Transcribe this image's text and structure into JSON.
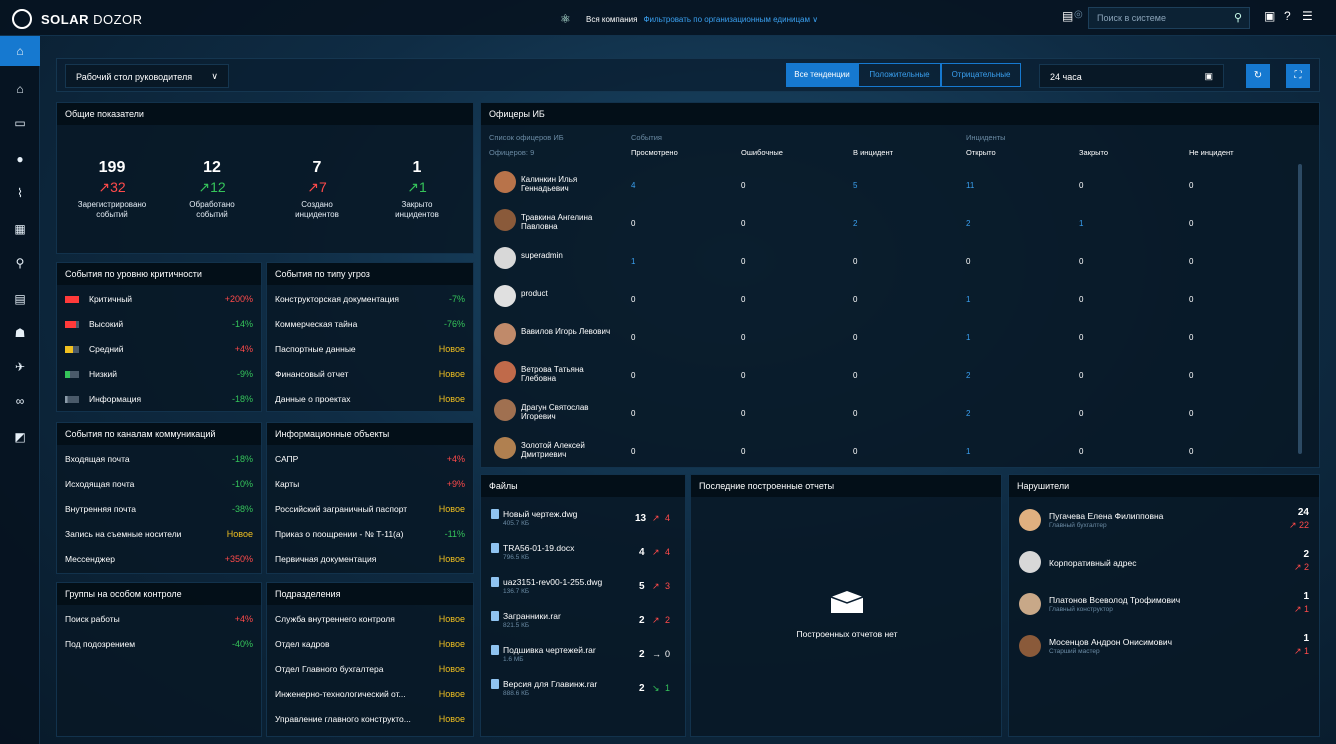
{
  "app": {
    "brand_bold": "SOLAR",
    "brand_rest": " DOZOR"
  },
  "header": {
    "company": "Вся компания",
    "filter_link": "Фильтровать по организационным единицам ∨",
    "search_placeholder": "Поиск в системе"
  },
  "toolbar": {
    "desktop_label": "Рабочий стол руководителя",
    "trend_all": "Все тенденции",
    "trend_positive": "Положительные",
    "trend_negative": "Отрицательные",
    "period": "24 часа"
  },
  "general": {
    "title": "Общие показатели",
    "items": [
      {
        "value": "199",
        "delta": "32",
        "label": "Зарегистрировано событий"
      },
      {
        "value": "12",
        "delta": "12",
        "label": "Обработано событий"
      },
      {
        "value": "7",
        "delta": "7",
        "label": "Создано инцидентов"
      },
      {
        "value": "1",
        "delta": "1",
        "label": "Закрыто инцидентов"
      }
    ]
  },
  "criticality": {
    "title": "События по уровню критичности",
    "rows": [
      {
        "label": "Критичный",
        "value": "+200%",
        "color": "#ff4a4a"
      },
      {
        "label": "Высокий",
        "value": "-14%",
        "color": "#ff4a4a"
      },
      {
        "label": "Средний",
        "value": "+4%",
        "color": "#f0c020"
      },
      {
        "label": "Низкий",
        "value": "-9%",
        "color": "#35c45a"
      },
      {
        "label": "Информация",
        "value": "-18%",
        "color": "#8a9aa8"
      }
    ]
  },
  "threats": {
    "title": "События по типу угроз",
    "rows": [
      {
        "label": "Конструкторская документация",
        "value": "-7%"
      },
      {
        "label": "Коммерческая тайна",
        "value": "-76%"
      },
      {
        "label": "Паспортные данные",
        "value": "Новое"
      },
      {
        "label": "Финансовый отчет",
        "value": "Новое"
      },
      {
        "label": "Данные о проектах",
        "value": "Новое"
      }
    ]
  },
  "channels": {
    "title": "События по каналам коммуникаций",
    "rows": [
      {
        "label": "Входящая почта",
        "value": "-18%"
      },
      {
        "label": "Исходящая почта",
        "value": "-10%"
      },
      {
        "label": "Внутренняя почта",
        "value": "-38%"
      },
      {
        "label": "Запись на съемные носители",
        "value": "Новое"
      },
      {
        "label": "Мессенджер",
        "value": "+350%"
      }
    ]
  },
  "infoobjects": {
    "title": "Информационные объекты",
    "rows": [
      {
        "label": "САПР",
        "value": "+4%"
      },
      {
        "label": "Карты",
        "value": "+9%"
      },
      {
        "label": "Российский заграничный паспорт",
        "value": "Новое"
      },
      {
        "label": "Приказ о поощрении - № Т-11(а)",
        "value": "-11%"
      },
      {
        "label": "Первичная документация",
        "value": "Новое"
      }
    ]
  },
  "groups": {
    "title": "Группы на особом контроле",
    "rows": [
      {
        "label": "Поиск работы",
        "value": "+4%"
      },
      {
        "label": "Под подозрением",
        "value": "-40%"
      }
    ]
  },
  "departments": {
    "title": "Подразделения",
    "rows": [
      {
        "label": "Служба внутреннего контроля",
        "value": "Новое"
      },
      {
        "label": "Отдел кадров",
        "value": "Новое"
      },
      {
        "label": "Отдел Главного бухгалтера",
        "value": "Новое"
      },
      {
        "label": "Инженерно-технологический от...",
        "value": "Новое"
      },
      {
        "label": "Управление главного конструкто...",
        "value": "Новое"
      }
    ]
  },
  "officers": {
    "title": "Офицеры ИБ",
    "list_label": "Список офицеров ИБ",
    "count_label": "Офицеров: 9",
    "events_group": "События",
    "incidents_group": "Инциденты",
    "columns": [
      "Просмотрено",
      "Ошибочные",
      "В инцидент",
      "Открыто",
      "Закрыто",
      "Не инцидент"
    ],
    "rows": [
      {
        "name": "Калинкин Илья Геннадьевич",
        "cells": [
          "4",
          "0",
          "5",
          "11",
          "0",
          "0"
        ]
      },
      {
        "name": "Травкина Ангелина Павловна",
        "cells": [
          "0",
          "0",
          "2",
          "2",
          "1",
          "0"
        ]
      },
      {
        "name": "superadmin",
        "cells": [
          "1",
          "0",
          "0",
          "0",
          "0",
          "0"
        ]
      },
      {
        "name": "product",
        "cells": [
          "0",
          "0",
          "0",
          "1",
          "0",
          "0"
        ]
      },
      {
        "name": "Вавилов Игорь Левович",
        "cells": [
          "0",
          "0",
          "0",
          "1",
          "0",
          "0"
        ]
      },
      {
        "name": "Ветрова Татьяна Глебовна",
        "cells": [
          "0",
          "0",
          "0",
          "2",
          "0",
          "0"
        ]
      },
      {
        "name": "Драгун Святослав Игоревич",
        "cells": [
          "0",
          "0",
          "0",
          "2",
          "0",
          "0"
        ]
      },
      {
        "name": "Золотой Алексей Дмитриевич",
        "cells": [
          "0",
          "0",
          "0",
          "1",
          "0",
          "0"
        ]
      }
    ]
  },
  "files": {
    "title": "Файлы",
    "rows": [
      {
        "name": "Новый чертеж.dwg",
        "size": "405.7 КБ",
        "count": "13",
        "delta": "4",
        "dir": "up"
      },
      {
        "name": "TRA56-01-19.docx",
        "size": "796.5 КБ",
        "count": "4",
        "delta": "4",
        "dir": "up"
      },
      {
        "name": "uaz3151-rev00-1-255.dwg",
        "size": "136.7 КБ",
        "count": "5",
        "delta": "3",
        "dir": "up"
      },
      {
        "name": "Загранники.rar",
        "size": "821.5 КБ",
        "count": "2",
        "delta": "2",
        "dir": "up"
      },
      {
        "name": "Подшивка чертежей.rar",
        "size": "1.6 МБ",
        "count": "2",
        "delta": "0",
        "dir": "flat"
      },
      {
        "name": "Версия для Главинж.rar",
        "size": "888.6 КБ",
        "count": "2",
        "delta": "1",
        "dir": "down"
      }
    ]
  },
  "reports": {
    "title": "Последние построенные отчеты",
    "empty": "Построенных отчетов нет"
  },
  "violators": {
    "title": "Нарушители",
    "rows": [
      {
        "name": "Пугачева Елена Филипповна",
        "role": "Главный бухгалтер",
        "count": "24",
        "delta": "22"
      },
      {
        "name": "Корпоративный адрес",
        "role": "",
        "count": "2",
        "delta": "2"
      },
      {
        "name": "Платонов Всеволод Трофимович",
        "role": "Главный конструктор",
        "count": "1",
        "delta": "1"
      },
      {
        "name": "Мосенцов Андрон Онисимович",
        "role": "Старший мастер",
        "count": "1",
        "delta": "1"
      }
    ]
  },
  "sidebar": {
    "items": [
      "home-icon",
      "bank-icon",
      "id-card-icon",
      "bitcoin-icon",
      "satellite-icon",
      "calendar-icon",
      "search-icon",
      "table-icon",
      "police-icon",
      "plane-icon",
      "binoculars-icon",
      "book-icon"
    ]
  }
}
